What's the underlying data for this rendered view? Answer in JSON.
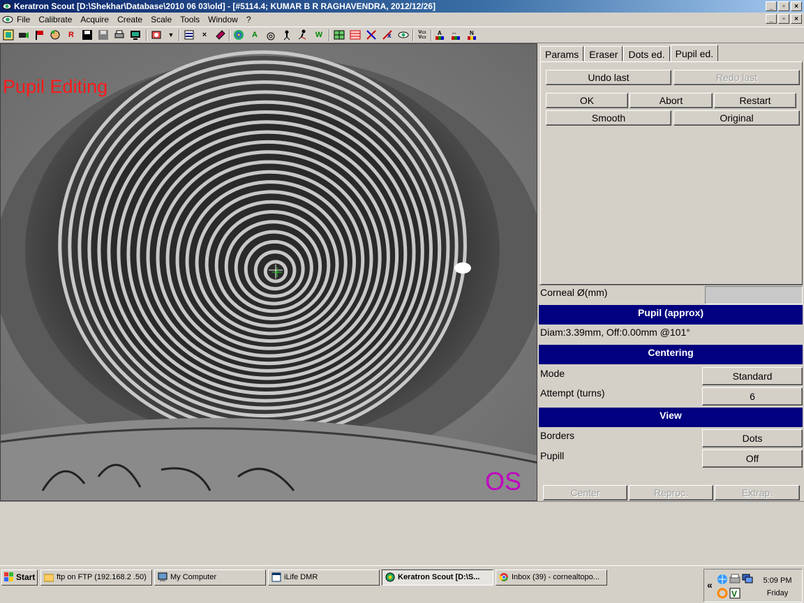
{
  "window": {
    "title": "Keratron Scout [D:\\Shekhar\\Database\\2010 06 03\\old] - [#5114.4; KUMAR B R RAGHAVENDRA, 2012/12/26]",
    "minimize": "_",
    "maximize": "▫",
    "close": "×"
  },
  "menu": [
    "File",
    "Calibrate",
    "Acquire",
    "Create",
    "Scale",
    "Tools",
    "Window",
    "?"
  ],
  "image": {
    "mode_label": "Pupil Editing",
    "eye_label": "OS"
  },
  "tabs": [
    "Params",
    "Eraser",
    "Dots ed.",
    "Pupil ed."
  ],
  "active_tab": "Pupil ed.",
  "pupil_edit": {
    "undo_last": "Undo last",
    "redo_last": "Redo last",
    "ok": "OK",
    "abort": "Abort",
    "restart": "Restart",
    "smooth": "Smooth",
    "original": "Original"
  },
  "info": {
    "corneal_label": "Corneal Ø(mm)",
    "corneal_value": "",
    "pupil_header": "Pupil (approx)",
    "pupil_text": "Diam:3.39mm, Off:0.00mm @101°",
    "centering_header": "Centering",
    "mode_label": "Mode",
    "mode_value": "Standard",
    "attempt_label": "Attempt (turns)",
    "attempt_value": "6",
    "view_header": "View",
    "borders_label": "Borders",
    "borders_value": "Dots",
    "pupil_label": "Pupill",
    "pupil_value": "Off"
  },
  "bottom_buttons": {
    "center": "Center",
    "reproc": "Reproc.",
    "extrap": "Extrap."
  },
  "taskbar": {
    "start": "Start",
    "items": [
      "ftp on FTP (192.168.2 .50)",
      "My Computer",
      "iLife DMR",
      "Keratron Scout [D:\\S...",
      "Inbox (39) - cornealtopo..."
    ],
    "tray_arrow": "«",
    "time": "5:09 PM",
    "day": "Friday"
  }
}
